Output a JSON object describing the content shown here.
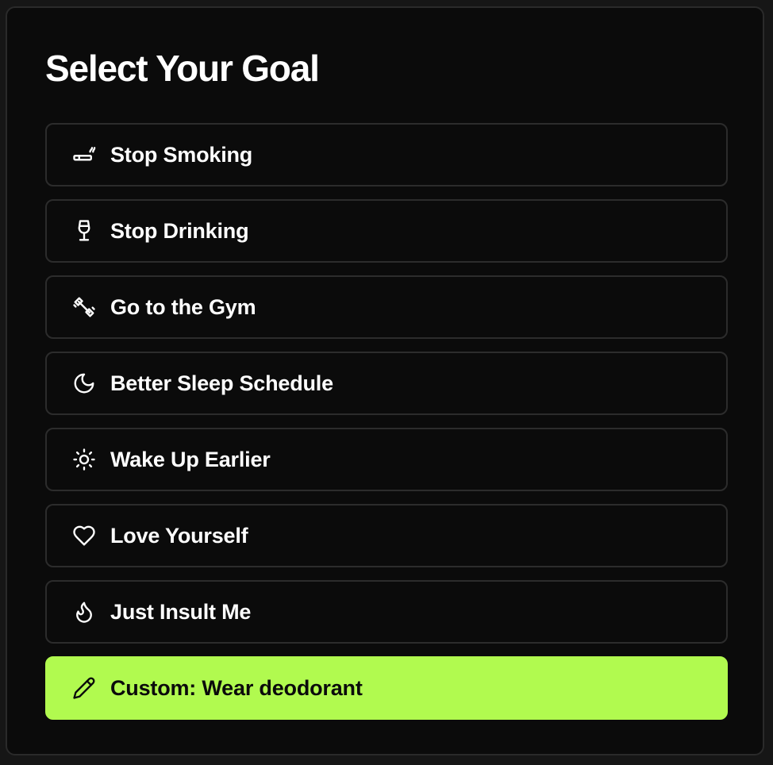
{
  "title": "Select Your Goal",
  "goals": [
    {
      "label": "Stop Smoking",
      "icon": "cigarette-icon",
      "selected": false
    },
    {
      "label": "Stop Drinking",
      "icon": "wine-glass-icon",
      "selected": false
    },
    {
      "label": "Go to the Gym",
      "icon": "dumbbell-icon",
      "selected": false
    },
    {
      "label": "Better Sleep Schedule",
      "icon": "moon-icon",
      "selected": false
    },
    {
      "label": "Wake Up Earlier",
      "icon": "sun-icon",
      "selected": false
    },
    {
      "label": "Love Yourself",
      "icon": "heart-icon",
      "selected": false
    },
    {
      "label": "Just Insult Me",
      "icon": "flame-icon",
      "selected": false
    },
    {
      "label": "Custom: Wear deodorant",
      "icon": "pencil-icon",
      "selected": true
    }
  ],
  "colors": {
    "background": "#0b0b0b",
    "accent": "#b1fa4f",
    "border": "#2c2c2c",
    "text": "#ffffff"
  }
}
